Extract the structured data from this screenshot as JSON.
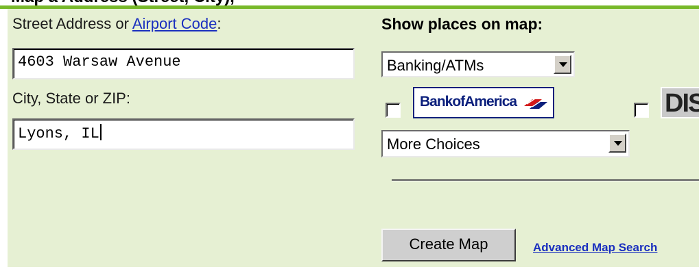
{
  "header": {
    "cutoff_text": "Map a Address (Street, City),"
  },
  "address": {
    "label_prefix": "Street Address or ",
    "airport_link": "Airport Code",
    "label_suffix": ":",
    "street_value": "4603 Warsaw Avenue",
    "city_label": "City, State or ZIP:",
    "city_value": "Lyons, IL"
  },
  "places": {
    "heading": "Show places on map:",
    "category_select": "Banking/ATMs",
    "more_select": "More Choices",
    "logos": {
      "boa": "BankofAmerica",
      "discover": "DIS"
    }
  },
  "actions": {
    "create_map": "Create Map",
    "advanced_link": "Advanced Map Search"
  },
  "colors": {
    "accent_green": "#78b92a",
    "panel_bg": "#e6f0d3",
    "link_blue": "#1a2fbf",
    "boa_blue": "#0b1f7c",
    "boa_red": "#d21a1a"
  }
}
